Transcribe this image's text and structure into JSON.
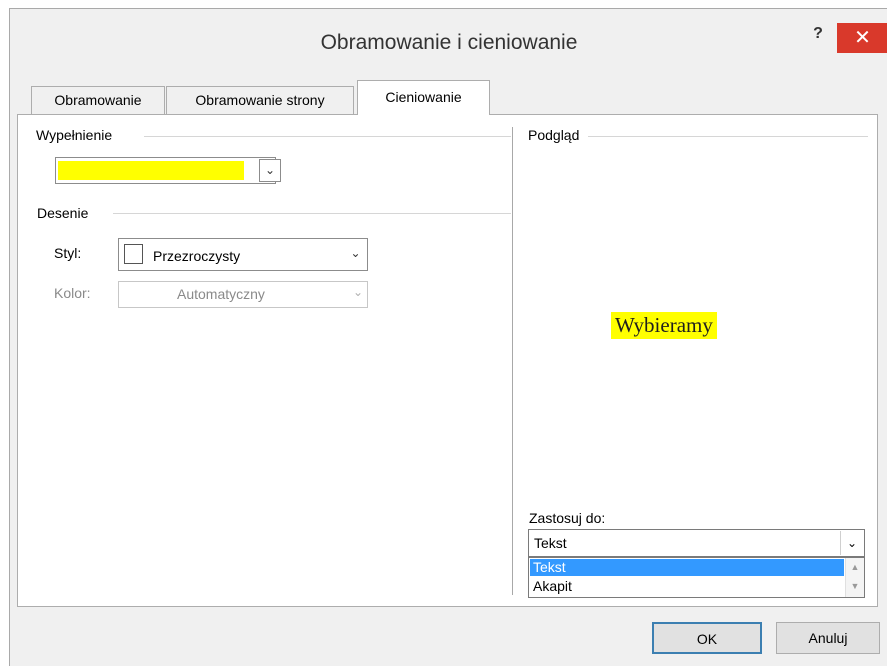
{
  "window": {
    "title": "Obramowanie i cieniowanie",
    "help_label": "?",
    "close_label": "✕"
  },
  "tabs": [
    {
      "label": "Obramowanie",
      "active": false
    },
    {
      "label": "Obramowanie strony",
      "active": false
    },
    {
      "label": "Cieniowanie",
      "active": true
    }
  ],
  "fill": {
    "label": "Wypełnienie",
    "color": "#FFFF00"
  },
  "patterns": {
    "label": "Desenie",
    "style_label": "Styl:",
    "style_value": "Przezroczysty",
    "color_label": "Kolor:",
    "color_value": "Automatyczny"
  },
  "preview": {
    "label": "Podgląd",
    "sample_text": "Wybieramy"
  },
  "apply_to": {
    "label": "Zastosuj do:",
    "value": "Tekst",
    "options": [
      "Tekst",
      "Akapit"
    ],
    "selected_index": 0
  },
  "buttons": {
    "ok": "OK",
    "cancel": "Anuluj"
  },
  "icons": {
    "dropdown": "chevron-down-icon",
    "close": "close-icon",
    "help": "help-icon"
  }
}
